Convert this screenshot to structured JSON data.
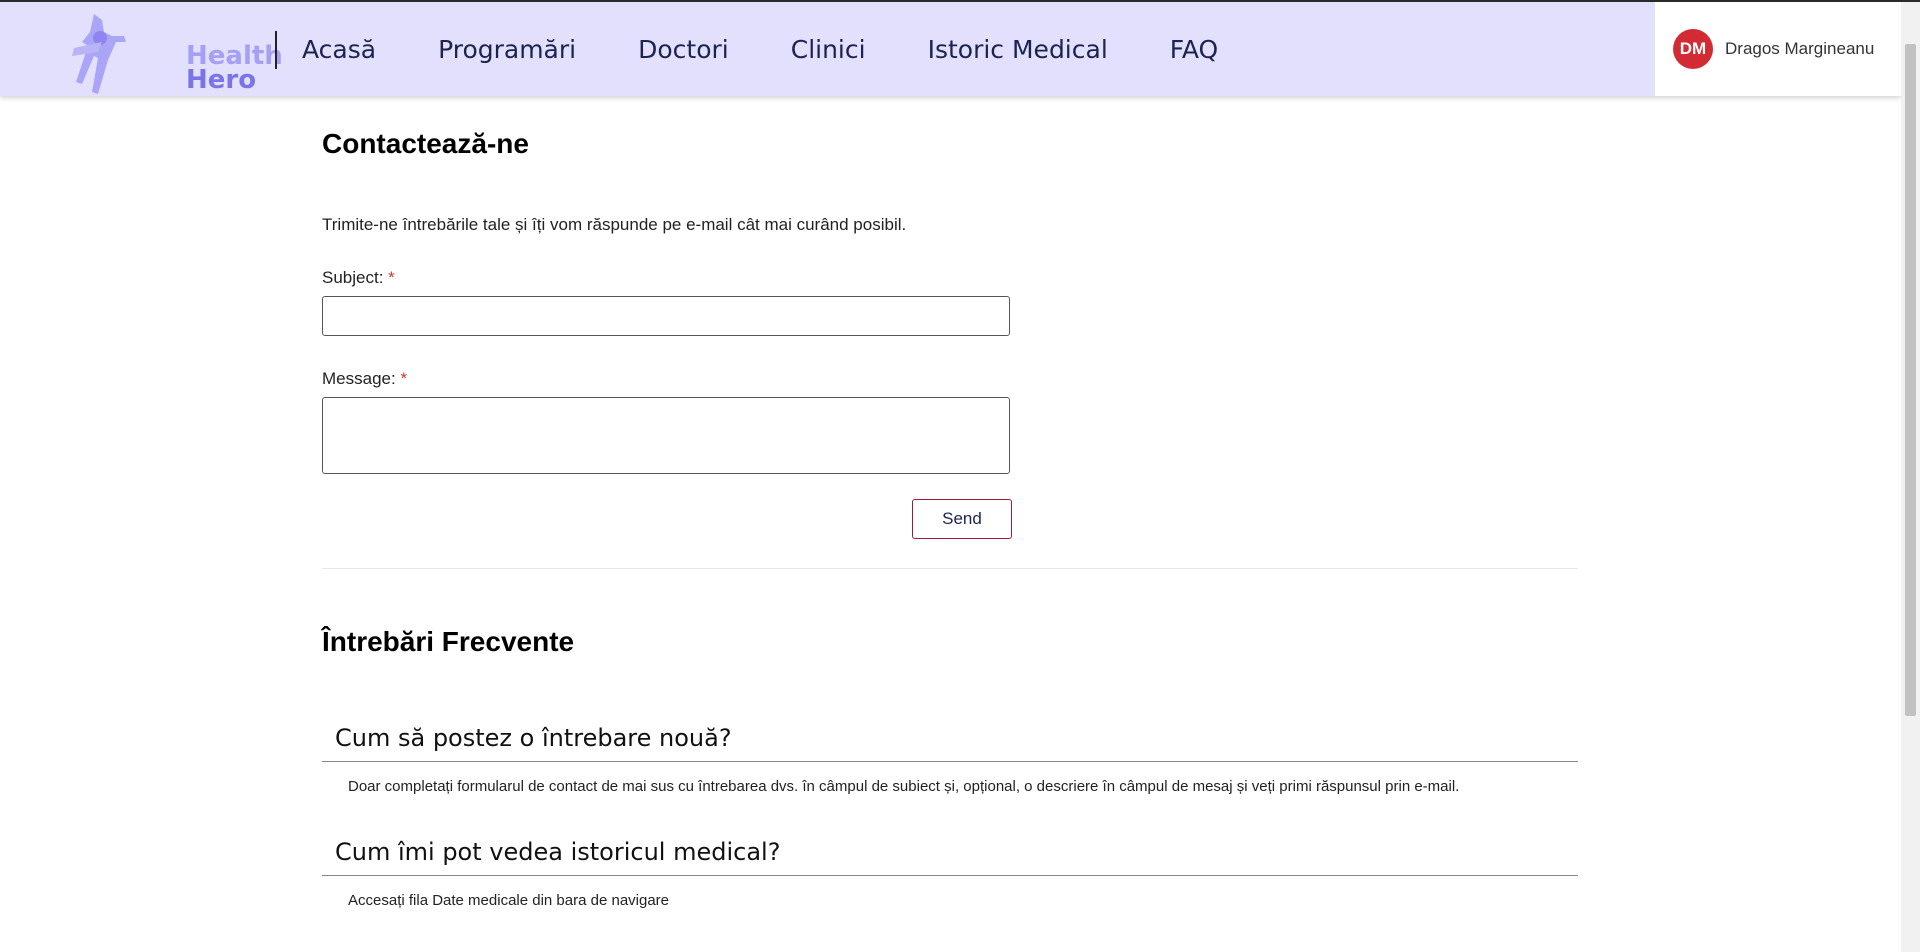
{
  "brand": {
    "line1": "Health",
    "line2": "Hero",
    "logo_icon": "superhero-figure-icon"
  },
  "nav": {
    "items": [
      {
        "label": "Acasă"
      },
      {
        "label": "Programări"
      },
      {
        "label": "Doctori"
      },
      {
        "label": "Clinici"
      },
      {
        "label": "Istoric Medical"
      },
      {
        "label": "FAQ"
      }
    ]
  },
  "user": {
    "initials": "DM",
    "name": "Dragos Margineanu",
    "avatar_color": "#d32b33"
  },
  "contact": {
    "title": "Contactează-ne",
    "intro": "Trimite-ne întrebările tale și îți vom răspunde pe e-mail cât mai curând posibil.",
    "subject_label": "Subject:",
    "message_label": "Message:",
    "required_mark": "*",
    "subject_value": "",
    "message_value": "",
    "send_label": "Send"
  },
  "faq": {
    "title": "Întrebări Frecvente",
    "items": [
      {
        "question": "Cum să postez o întrebare nouă?",
        "answer": "Doar completați formularul de contact de mai sus cu întrebarea dvs. în câmpul de subiect și, opțional, o descriere în câmpul de mesaj și veți primi răspunsul prin e-mail."
      },
      {
        "question": "Cum îmi pot vedea istoricul medical?",
        "answer": "Accesați fila Date medicale din bara de navigare"
      }
    ]
  },
  "colors": {
    "navbar_bg": "#e2e0fd",
    "brand_purple": "#8e86f0",
    "send_border": "#9b1d3a",
    "required": "#d13438"
  }
}
